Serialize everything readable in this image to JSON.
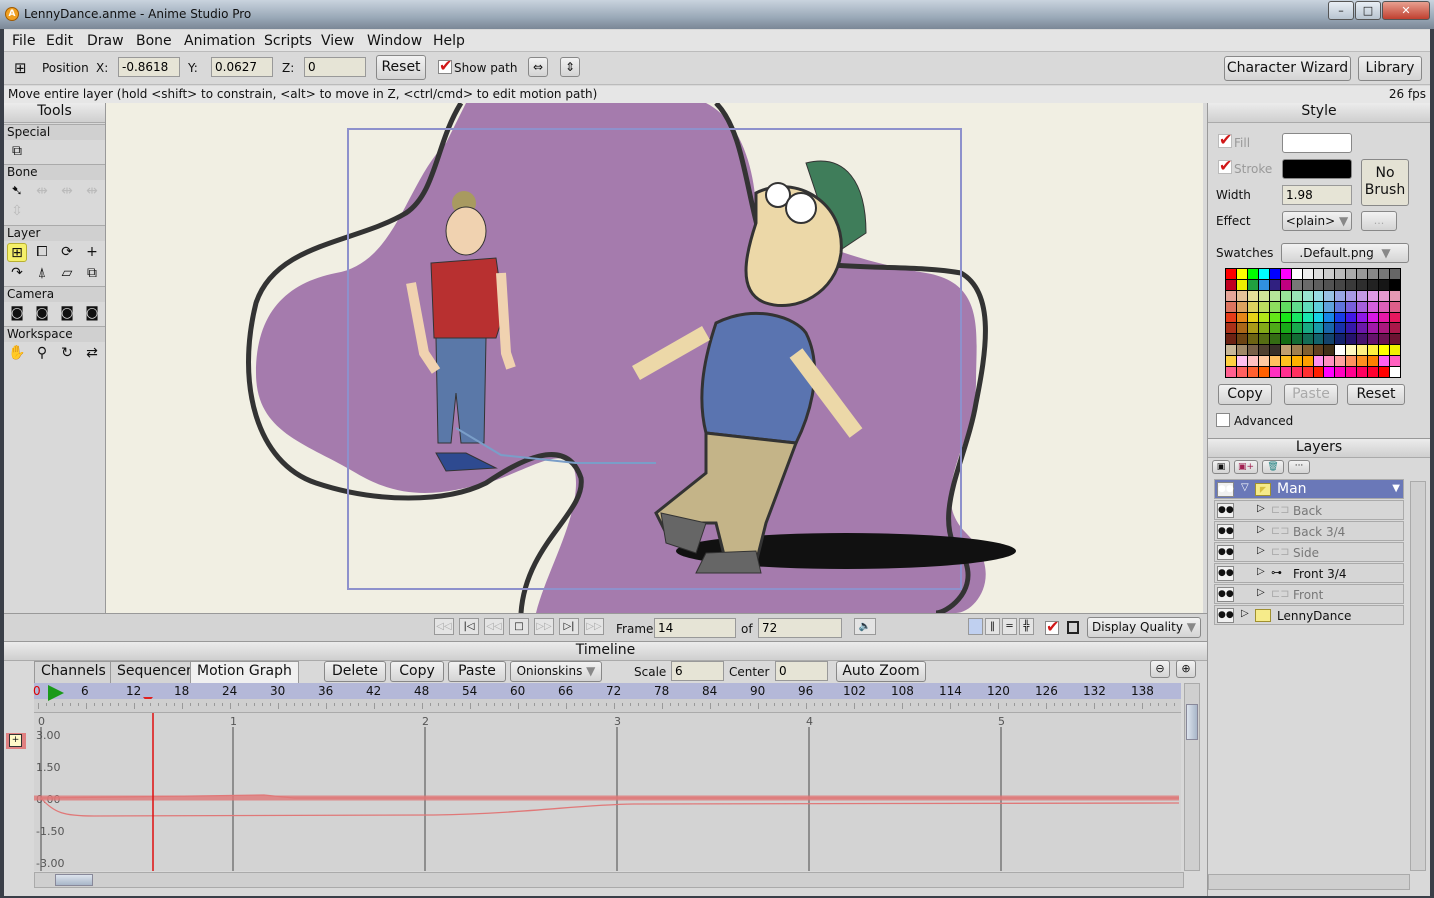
{
  "window": {
    "title": "LennyDance.anme - Anime Studio Pro",
    "app_icon": "A",
    "min": "–",
    "max": "□",
    "close": "✕"
  },
  "menu": [
    "File",
    "Edit",
    "Draw",
    "Bone",
    "Animation",
    "Scripts",
    "View",
    "Window",
    "Help"
  ],
  "options": {
    "position_label": "Position",
    "x_label": "X:",
    "x": "-0.8618",
    "y_label": "Y:",
    "y": "0.0627",
    "z_label": "Z:",
    "z": "0",
    "reset": "Reset",
    "show_path": "Show path",
    "show_path_checked": true,
    "character_wizard": "Character Wizard",
    "library": "Library"
  },
  "status": {
    "hint": "Move entire layer (hold <shift> to constrain, <alt> to move in Z, <ctrl/cmd> to edit motion path)",
    "fps": "26 fps"
  },
  "tools": {
    "title": "Tools",
    "sections": {
      "special": "Special",
      "bone": "Bone",
      "layer": "Layer",
      "camera": "Camera",
      "workspace": "Workspace"
    }
  },
  "style": {
    "title": "Style",
    "fill": "Fill",
    "stroke": "Stroke",
    "fill_color": "#ffffff",
    "stroke_color": "#000000",
    "width_label": "Width",
    "width": "1.98",
    "effect_label": "Effect",
    "effect": "<plain>",
    "effect_more": "...",
    "no_brush": "No Brush",
    "swatches_label": "Swatches",
    "swatches": ".Default.png",
    "copy": "Copy",
    "paste": "Paste",
    "reset": "Reset",
    "advanced": "Advanced"
  },
  "layers": {
    "title": "Layers",
    "items": [
      {
        "name": "Man",
        "type": "folder-bone",
        "expanded": true,
        "selected": true
      },
      {
        "name": "Back",
        "type": "switch",
        "dim": true
      },
      {
        "name": "Back 3/4",
        "type": "switch",
        "dim": true
      },
      {
        "name": "Side",
        "type": "switch",
        "dim": true
      },
      {
        "name": "Front 3/4",
        "type": "bone",
        "dim": false
      },
      {
        "name": "Front",
        "type": "switch",
        "dim": true
      },
      {
        "name": "LennyDance",
        "type": "folder",
        "dim": false
      }
    ]
  },
  "playback": {
    "frame_label": "Frame",
    "frame": "14",
    "of_label": "of",
    "total": "72",
    "display_quality": "Display Quality"
  },
  "timeline": {
    "title": "Timeline",
    "tabs": [
      "Channels",
      "Sequencer",
      "Motion Graph"
    ],
    "active_tab": "Motion Graph",
    "delete": "Delete",
    "copy": "Copy",
    "paste": "Paste",
    "onionskins": "Onionskins",
    "scale_label": "Scale",
    "scale": "6",
    "center_label": "Center",
    "center": "0",
    "auto_zoom": "Auto Zoom",
    "ruler": [
      "0",
      "6",
      "12",
      "18",
      "24",
      "30",
      "36",
      "42",
      "48",
      "54",
      "60",
      "66",
      "72",
      "78",
      "84",
      "90",
      "96",
      "102",
      "108",
      "114",
      "120",
      "126",
      "132",
      "138"
    ],
    "seconds": [
      "0",
      "1",
      "2",
      "3",
      "4",
      "5"
    ],
    "y_ticks": [
      "3.00",
      "1.50",
      "0.00",
      "-1.50",
      "-3.00"
    ],
    "current_frame": 14
  },
  "colors": {
    "canvas_bg": "#f1efe3",
    "blob": "#a57bad",
    "selection": "#5d6fa8",
    "ruler": "#b4b8d8",
    "curve": "#e07878"
  }
}
